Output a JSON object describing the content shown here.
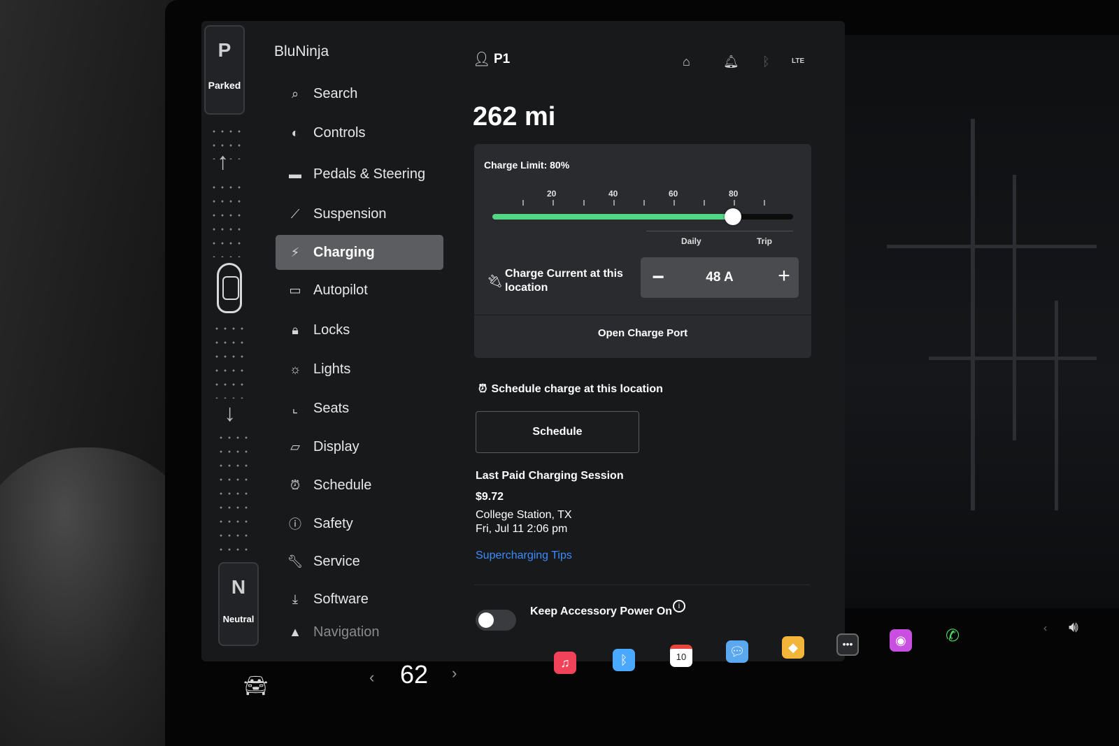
{
  "gear": {
    "top_letter": "P",
    "top_label": "Parked",
    "bottom_letter": "N",
    "bottom_label": "Neutral"
  },
  "sidebar": {
    "profile_name": "BluNinja",
    "items": [
      {
        "label": "Search",
        "icon": "search-icon"
      },
      {
        "label": "Controls",
        "icon": "toggle-icon"
      },
      {
        "label": "Pedals & Steering",
        "icon": "car-icon"
      },
      {
        "label": "Suspension",
        "icon": "wrench-icon"
      },
      {
        "label": "Charging",
        "icon": "lightning-icon",
        "active": true
      },
      {
        "label": "Autopilot",
        "icon": "steering-icon"
      },
      {
        "label": "Locks",
        "icon": "lock-icon"
      },
      {
        "label": "Lights",
        "icon": "sun-icon"
      },
      {
        "label": "Seats",
        "icon": "seat-icon"
      },
      {
        "label": "Display",
        "icon": "display-icon"
      },
      {
        "label": "Schedule",
        "icon": "alarm-icon"
      },
      {
        "label": "Safety",
        "icon": "alert-icon"
      },
      {
        "label": "Service",
        "icon": "wrench-icon"
      },
      {
        "label": "Software",
        "icon": "download-icon"
      },
      {
        "label": "Navigation",
        "icon": "navigation-icon"
      }
    ]
  },
  "topbar": {
    "user": "P1",
    "status_icons": [
      "home-icon",
      "bell-icon",
      "bluetooth-icon",
      "lte-signal-icon"
    ],
    "lte_text": "LTE"
  },
  "range": "262 mi",
  "charging": {
    "limit_label": "Charge Limit: 80%",
    "limit_percent": 80,
    "ticks": [
      "20",
      "40",
      "60",
      "80"
    ],
    "daily_label": "Daily",
    "trip_label": "Trip",
    "current_label": "Charge Current at this location",
    "current_value": "48 A",
    "minus": "−",
    "plus": "+",
    "open_port": "Open Charge Port",
    "schedule_text": "Schedule charge at this location",
    "schedule_button": "Schedule",
    "last_session_title": "Last Paid Charging Session",
    "last_session_price": "$9.72",
    "last_session_location": "College Station, TX",
    "last_session_time": "Fri, Jul 11 2:06 pm",
    "tips_link": "Supercharging Tips",
    "accessory_label": "Keep Accessory Power On",
    "accessory_on": false,
    "fill_color": "#52d686"
  },
  "dock": {
    "temperature": "62",
    "left_chevron": "‹",
    "right_chevron": "›",
    "calendar_day": "10",
    "apps": [
      "music-icon",
      "bluetooth-icon",
      "calendar-icon",
      "messages-icon",
      "toybox-icon",
      "more-icon",
      "podcast-icon",
      "phone-icon"
    ]
  }
}
